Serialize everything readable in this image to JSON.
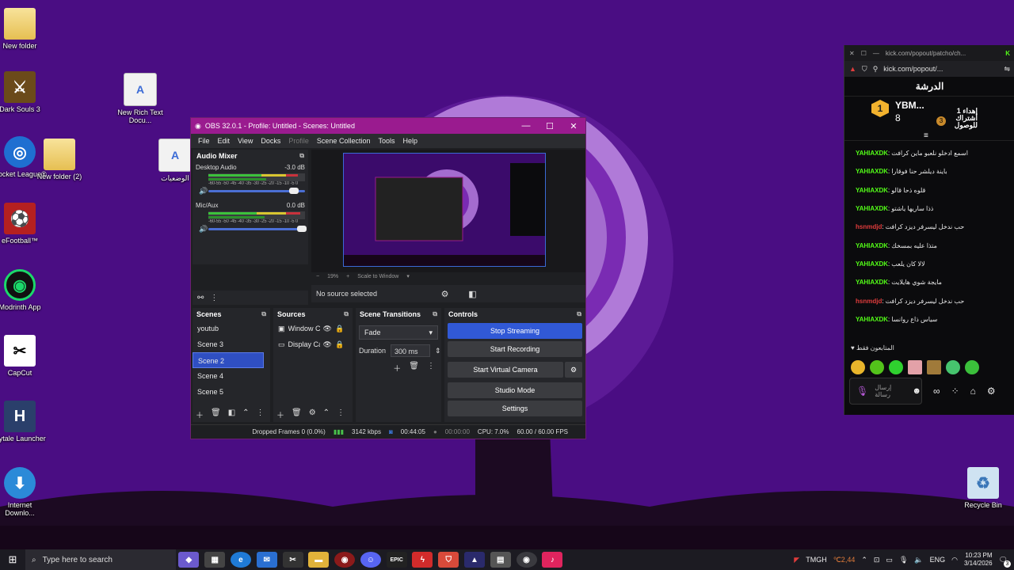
{
  "desktop": {
    "icons": [
      {
        "label": "New folder"
      },
      {
        "label": "Dark Souls 3"
      },
      {
        "label": "New Rich Text Docu..."
      },
      {
        "label": "Rocket League®"
      },
      {
        "label": "New folder (2)"
      },
      {
        "label": "الوضعيات"
      },
      {
        "label": "eFootball™"
      },
      {
        "label": "Modrinth App"
      },
      {
        "label": "CapCut"
      },
      {
        "label": "Hytale Launcher"
      },
      {
        "label": "Internet Downlo..."
      },
      {
        "label": "Recycle Bin"
      }
    ]
  },
  "obs": {
    "title": "OBS 32.0.1 - Profile: Untitled - Scenes: Untitled",
    "menu": [
      "File",
      "Edit",
      "View",
      "Docks",
      "Profile",
      "Scene Collection",
      "Tools",
      "Help"
    ],
    "mixer": {
      "title": "Audio Mixer",
      "channels": [
        {
          "name": "Desktop Audio",
          "db": "-3.0 dB",
          "level": 0.93
        },
        {
          "name": "Mic/Aux",
          "db": "0.0 dB",
          "level": 1.0
        }
      ],
      "scale": "-60-55 -50 -45 -40 -35 -30 -25 -20 -15 -10 -5 0"
    },
    "preview": {
      "zoom": "19%",
      "scale_mode": "Scale to Window"
    },
    "source_bar": {
      "text": "No source selected"
    },
    "scenes": {
      "title": "Scenes",
      "items": [
        "youtub",
        "Scene 3",
        "Scene 2",
        "Scene 4",
        "Scene 5"
      ],
      "selected": "Scene 2"
    },
    "sources": {
      "title": "Sources",
      "items": [
        "Window C",
        "Display Ca"
      ]
    },
    "transitions": {
      "title": "Scene Transitions",
      "type": "Fade",
      "duration_label": "Duration",
      "duration": "300 ms"
    },
    "controls": {
      "title": "Controls",
      "buttons": [
        "Stop Streaming",
        "Start Recording",
        "Start Virtual Camera",
        "Studio Mode",
        "Settings"
      ]
    },
    "status": {
      "dropped": "Dropped Frames 0 (0.0%)",
      "kbps": "3142 kbps",
      "stream_time": "00:44:05",
      "rec_time": "00:00:00",
      "cpu": "CPU: 7.0%",
      "fps": "60.00 / 60.00 FPS"
    }
  },
  "kick": {
    "tab_url": "kick.com/popout/patcho/ch...",
    "address": "kick.com/popout/...",
    "header": "الدرشة",
    "pinned": {
      "user": "YBM...",
      "count": "8",
      "badge": "1",
      "gift_text": "إهداء 1 اشتراك للوصول",
      "level": "3"
    },
    "messages": [
      {
        "user": "YAHIAXDK",
        "text": "اسمع ادخلو نلعبو ماين كرافت",
        "color": "green"
      },
      {
        "user": "YAHIAXDK",
        "text": "باينة ديلشر حنا فوقارا",
        "color": "green"
      },
      {
        "user": "YAHIAXDK",
        "text": "قلوه ذحا قالو",
        "color": "green"
      },
      {
        "user": "YAHIAXDK",
        "text": "ذذا ساريها ياشتو",
        "color": "green"
      },
      {
        "user": "hsnmdjd",
        "text": "حب ندخل ليسرفر ديزد كرافت",
        "color": "red"
      },
      {
        "user": "YAHIAXDK",
        "text": "متذا عليه بمسخك",
        "color": "green"
      },
      {
        "user": "YAHIAXDK",
        "text": "لالا كان يلعب",
        "color": "green"
      },
      {
        "user": "YAHIAXDK",
        "text": "مايجة شوي هايلايت",
        "color": "green"
      },
      {
        "user": "hsnmdjd",
        "text": "حب ندخل ليسرفر ديزد كرافت",
        "color": "red"
      },
      {
        "user": "YAHIAXDK",
        "text": "سياس ذاع روانسا",
        "color": "green"
      }
    ],
    "followers_only": "المتابعون فقط",
    "input_placeholder": "إرسال رسالة"
  },
  "taskbar": {
    "search_placeholder": "Type here to search",
    "tray": {
      "app": "TMGH",
      "weather": "℃2,44",
      "lang": "ENG",
      "time": "10:23 PM",
      "date": "3/14/2026",
      "notif": "3"
    }
  },
  "colors": {
    "wallpaper": "#4a0d83",
    "obs_title": "#9a1b8f",
    "accent": "#3159d6",
    "kick_green": "#53fc18"
  }
}
